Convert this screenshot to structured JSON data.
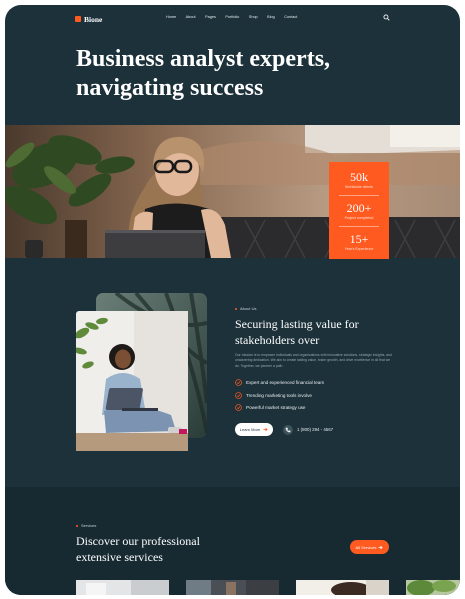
{
  "nav": {
    "logo": "Bione",
    "items": [
      "Home",
      "About",
      "Pages",
      "Portfolio",
      "Shop",
      "Blog",
      "Contact"
    ]
  },
  "hero": {
    "title_line1": "Business analyst experts,",
    "title_line2": "navigating success",
    "stats": [
      {
        "value": "50k",
        "label": "Worldwide clients"
      },
      {
        "value": "200+",
        "label": "Project completed"
      },
      {
        "value": "15+",
        "label": "Year's Experience"
      }
    ]
  },
  "about": {
    "kicker": "About Us",
    "title_line1": "Securing lasting value for",
    "title_line2": "stakeholders over",
    "description": "Our mission is to empower individuals and organizations with innovative solutions, strategic insights, and unwavering dedication. We aim to create lasting value, foster growth, and drive excellence in all that we do. Together, we pioneer a path.",
    "features": [
      "Expert and experienced financial team",
      "Trending marketing tools involve",
      "Powerful market strategy use"
    ],
    "button_label": "Learn More",
    "phone": "1 (800) 294 - 4567"
  },
  "services": {
    "kicker": "Services",
    "title_line1": "Discover our professional",
    "title_line2": "extensive services",
    "button_label": "All Services"
  },
  "colors": {
    "background": "#1c313a",
    "accent": "#ff5a1f",
    "services_band": "#172a32"
  }
}
